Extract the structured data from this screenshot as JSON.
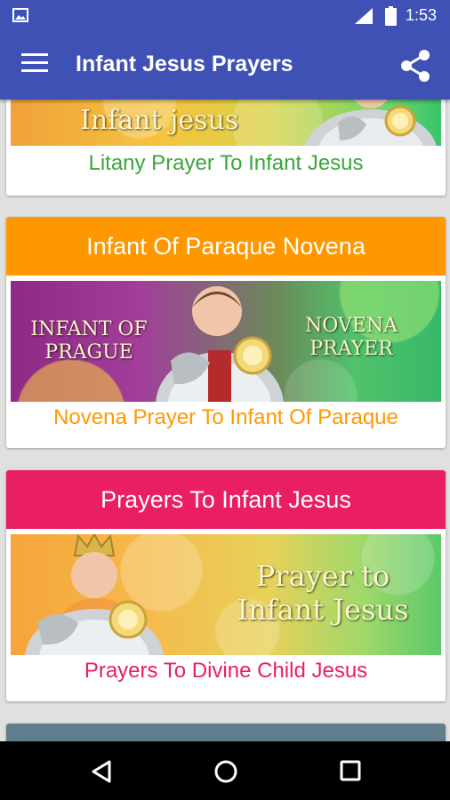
{
  "status_bar": {
    "time": "1:53"
  },
  "app_bar": {
    "title": "Infant Jesus Prayers"
  },
  "cards": {
    "litany": {
      "banner_text": "Infant jesus",
      "caption": "Litany Prayer To Infant Jesus",
      "caption_color": "#3aa63a"
    },
    "novena": {
      "header": "Infant Of Paraque Novena",
      "header_color": "#ff9800",
      "banner_left_line1": "INFANT OF",
      "banner_left_line2": "PRAGUE",
      "banner_right_line1": "NOVENA",
      "banner_right_line2": "PRAYER",
      "caption": "Novena Prayer To Infant Of Paraque",
      "caption_color": "#ff9800"
    },
    "prayers": {
      "header": "Prayers To Infant Jesus",
      "header_color": "#e91e63",
      "banner_line1": "Prayer to",
      "banner_line2": "Infant Jesus",
      "caption": "Prayers To Divine Child Jesus",
      "caption_color": "#e91e63"
    },
    "next": {
      "header_color": "#607d8b"
    }
  }
}
